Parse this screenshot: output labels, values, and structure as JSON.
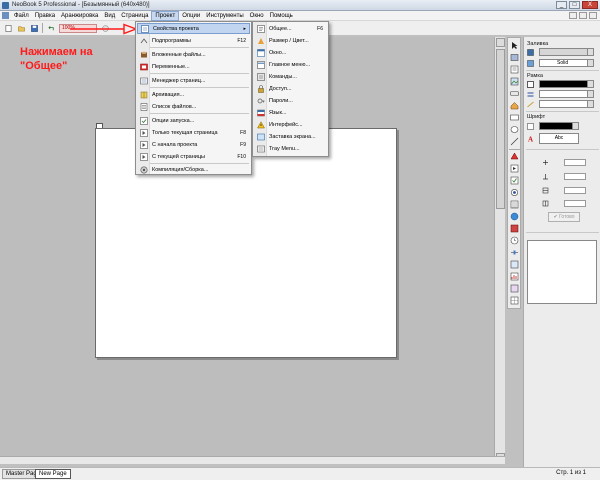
{
  "window": {
    "title": "NeoBook 5 Professional - [Безымянный (640x480)]",
    "buttons": [
      "_",
      "□",
      "X"
    ]
  },
  "menubar": {
    "items": [
      "Файл",
      "Правка",
      "Аранжировка",
      "Вид",
      "Страница",
      "Проект",
      "Опции",
      "Инструменты",
      "Окно",
      "Помощь"
    ],
    "active": "Проект"
  },
  "toolbar": {
    "zoom_value": "100%"
  },
  "annotation": {
    "line1": "Нажимаем на",
    "line2": "\"Общее\""
  },
  "project_menu": {
    "items": [
      {
        "label": "Свойства проекта",
        "shortcut": "",
        "submenu": true,
        "icon": "properties-icon"
      },
      {
        "label": "Подпрограммы",
        "shortcut": "F12",
        "icon": "subroutine-icon"
      },
      {
        "label": "Вложенные файлы...",
        "shortcut": "",
        "icon": "attached-files-icon"
      },
      {
        "label": "Переменные...",
        "shortcut": "",
        "icon": "variables-icon"
      },
      {
        "label": "Менеджер страниц...",
        "shortcut": "",
        "icon": "page-manager-icon"
      },
      {
        "label": "Архивация...",
        "shortcut": "",
        "icon": "archive-icon"
      },
      {
        "label": "Список файлов...",
        "shortcut": "",
        "icon": "file-list-icon"
      },
      {
        "label": "Опции запуска...",
        "shortcut": "",
        "icon": "run-options-icon"
      },
      {
        "label": "Только текущая страница",
        "shortcut": "F8",
        "icon": "current-page-icon"
      },
      {
        "label": "С начала проекта",
        "shortcut": "F9",
        "icon": "from-start-icon"
      },
      {
        "label": "С текущей страницы",
        "shortcut": "F10",
        "icon": "from-current-icon"
      },
      {
        "label": "Компиляция/Сборка...",
        "shortcut": "",
        "icon": "compile-icon"
      }
    ]
  },
  "properties_submenu": {
    "items": [
      {
        "label": "Общее...",
        "shortcut": "F6",
        "icon": "general-icon"
      },
      {
        "label": "Размер / Цвет...",
        "shortcut": "",
        "icon": "size-color-icon"
      },
      {
        "label": "Окно...",
        "shortcut": "",
        "icon": "window-icon"
      },
      {
        "label": "Главное меню...",
        "shortcut": "",
        "icon": "main-menu-icon"
      },
      {
        "label": "Команды...",
        "shortcut": "",
        "icon": "commands-icon"
      },
      {
        "label": "Доступ...",
        "shortcut": "",
        "icon": "access-icon"
      },
      {
        "label": "Пароли...",
        "shortcut": "",
        "icon": "passwords-icon"
      },
      {
        "label": "Язык...",
        "shortcut": "",
        "icon": "language-icon"
      },
      {
        "label": "Интерфейс...",
        "shortcut": "",
        "icon": "interface-icon"
      },
      {
        "label": "Заставка экрана...",
        "shortcut": "",
        "icon": "splash-screen-icon"
      },
      {
        "label": "Tray Menu...",
        "shortcut": "",
        "icon": "tray-menu-icon"
      }
    ]
  },
  "props_panel": {
    "fill_label": "Заливка",
    "fill_style": "Solid",
    "frame_label": "Рамка",
    "font_label": "Шрифт",
    "font_sample": "Abc",
    "done_button": "Готово"
  },
  "pages": {
    "tabs": [
      "Master Page",
      "New Page"
    ],
    "active": "New Page"
  },
  "status": {
    "page_info": "Стр. 1 из 1"
  },
  "colors": {
    "annotation": "#ff1a1a",
    "menu_highlight": "#c2d5f0",
    "work_area": "#bdbdbd"
  }
}
